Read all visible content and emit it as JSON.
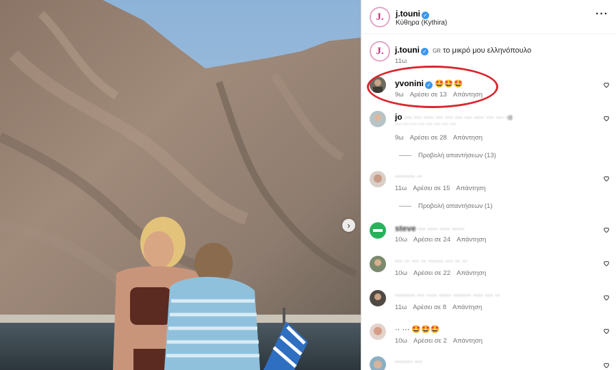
{
  "post": {
    "username": "j.touni",
    "location": "Κύθηρα (Kythira)",
    "avatar_letter": "J."
  },
  "caption": {
    "username": "j.touni",
    "flag_code": "GR",
    "text": "το μικρό μου ελληνόπουλο",
    "time": "11ω"
  },
  "comments": [
    {
      "username": "yvonini",
      "verified": true,
      "text": "🤩🤩🤩",
      "time": "9ω",
      "likes": "Αρέσει σε 13",
      "reply": "Απάντηση"
    },
    {
      "username": "jo",
      "text": "··· ··· ···· ··· ··· ··· ··· ···· ··· ··· ·α",
      "text2": "··· ··· ··· ··· ··· ··· ··· ···",
      "time": "9ω",
      "likes": "Αρέσει σε 28",
      "reply": "Απάντηση",
      "view_replies": "Προβολή απαντήσεων (13)"
    },
    {
      "username": "",
      "text": "········ ··",
      "time": "11ω",
      "likes": "Αρέσει σε 15",
      "reply": "Απάντηση",
      "view_replies": "Προβολή απαντήσεων (1)"
    },
    {
      "username": "steve",
      "text": "··· ···· ···· ·····",
      "time": "10ω",
      "likes": "Αρέσει σε 24",
      "reply": "Απάντηση"
    },
    {
      "username": "",
      "text": "··· ·· ··· ·· ······ ··· ·· ··",
      "time": "10ω",
      "likes": "Αρέσει σε 22",
      "reply": "Απάντηση"
    },
    {
      "username": "",
      "text": "········ ··· ···· ····· ······· ···· ··· ··",
      "time": "11ω",
      "likes": "Αρέσει σε 8",
      "reply": "Απάντηση"
    },
    {
      "username": "",
      "text": "·· ··· 🤩🤩🤩",
      "time": "10ω",
      "likes": "Αρέσει σε 2",
      "reply": "Απάντηση"
    },
    {
      "username": "",
      "text": "······· ···",
      "time": "",
      "likes": "",
      "reply": ""
    }
  ],
  "colors": {
    "verified": "#3897f0",
    "highlight_ring": "#d9262e",
    "meta_text": "#737373"
  }
}
